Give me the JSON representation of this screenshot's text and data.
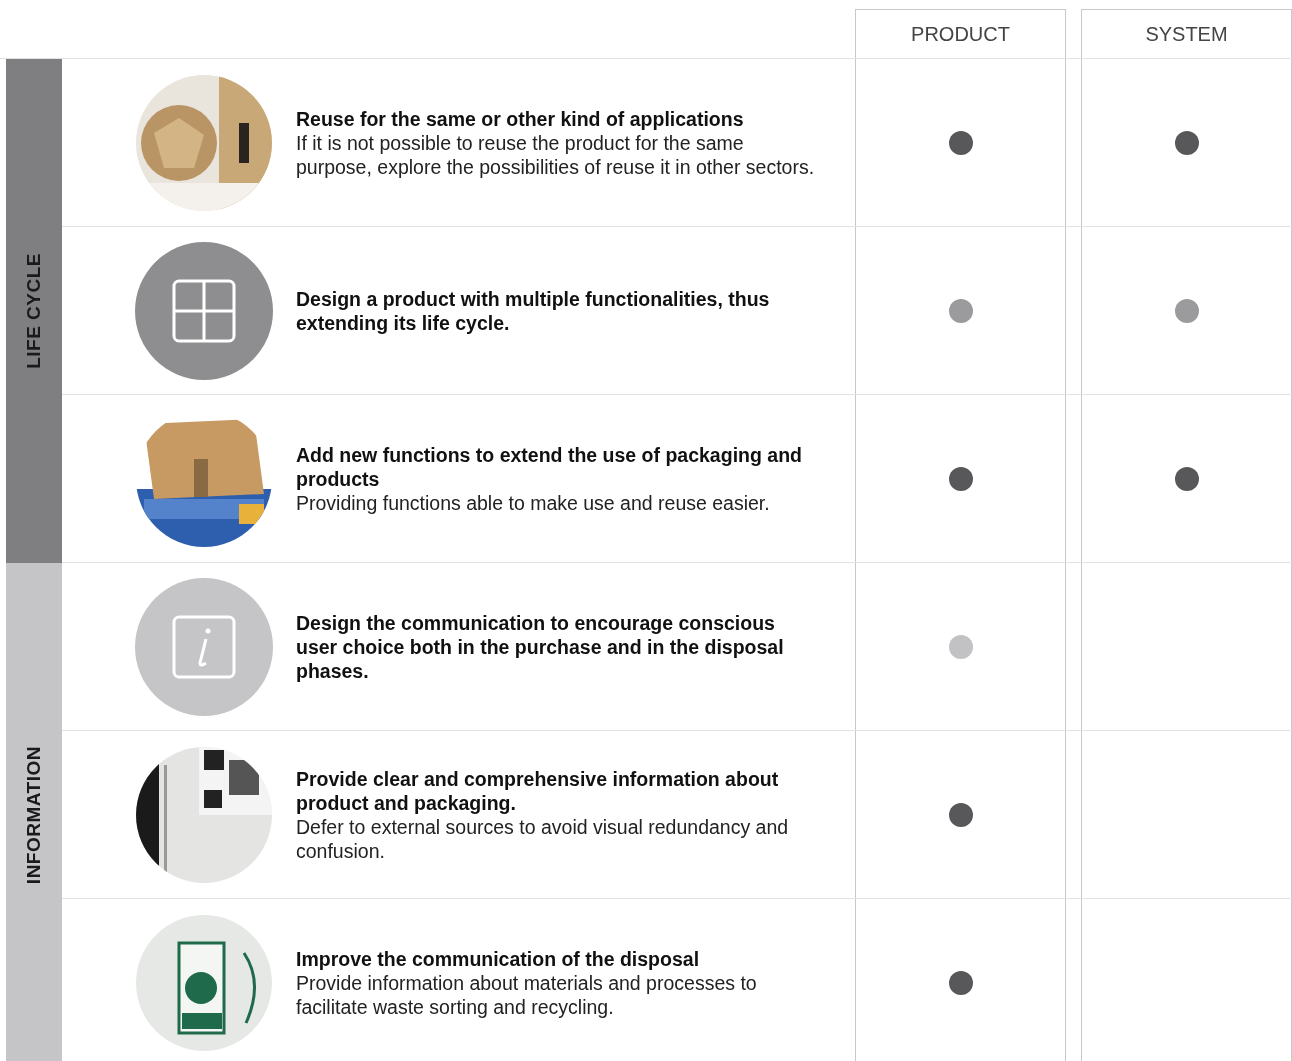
{
  "columns": [
    "PRODUCT",
    "SYSTEM"
  ],
  "groups": [
    {
      "label": "LIFE CYCLE",
      "color": "#7f7f81",
      "rows": [
        {
          "kind": "picture",
          "title": "Reuse for the same or other kind of applications",
          "body": "If it is not possible to reuse the product for the same purpose, explore the possibilities of reuse it in other sectors.",
          "product": {
            "color": "#58585a"
          },
          "system": {
            "color": "#58585a"
          }
        },
        {
          "kind": "grid",
          "title": "Design a product with multiple functionalities, thus extending its life cycle.",
          "product": {
            "color": "#9b9b9d"
          },
          "system": {
            "color": "#9b9b9d"
          }
        },
        {
          "kind": "picture",
          "title": "Add new functions to extend the use of packaging and products",
          "body": "Providing functions able to make use and reuse easier.",
          "product": {
            "color": "#58585a"
          },
          "system": {
            "color": "#58585a"
          }
        }
      ]
    },
    {
      "label": "INFORMATION",
      "color": "#c5c5c7",
      "rows": [
        {
          "kind": "info",
          "title": "Design the communication to encourage conscious user choice both in the purchase and in the disposal phases.",
          "product": {
            "color": "#c2c2c4"
          }
        },
        {
          "kind": "picture",
          "title": "Provide clear and comprehensive information about product and packaging.",
          "body": "Defer to external sources to avoid visual redundancy and confusion.",
          "product": {
            "color": "#58585a"
          }
        },
        {
          "kind": "picture",
          "title": "Improve the communication of the disposal",
          "body": "Provide information about materials and processes to facilitate waste sorting and recycling.",
          "product": {
            "color": "#58585a"
          }
        }
      ]
    }
  ]
}
